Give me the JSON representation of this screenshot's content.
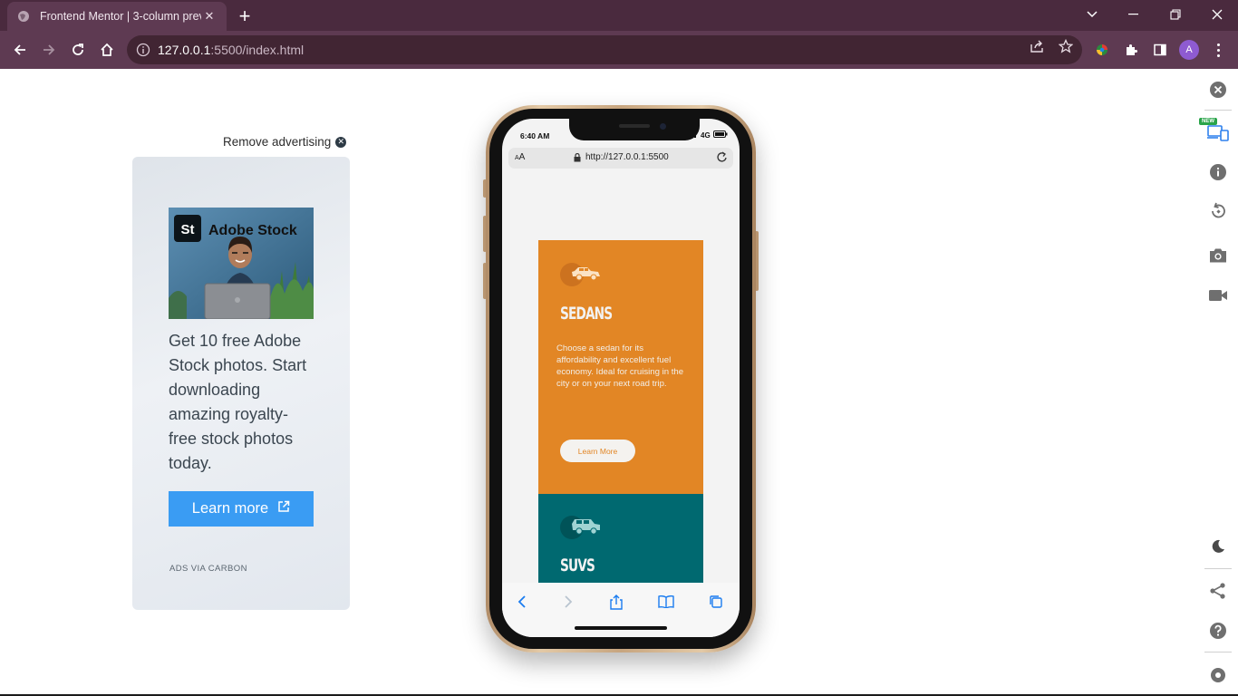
{
  "browser": {
    "tab_title": "Frontend Mentor | 3-column prev",
    "url_host": "127.0.0.1",
    "url_path": ":5500/index.html",
    "profile_initial": "A"
  },
  "ad": {
    "remove_label": "Remove advertising",
    "logo_text": "Adobe Stock",
    "logo_mark": "St",
    "body": "Get 10 free Adobe Stock photos. Start downloading amazing royalty-free stock photos today.",
    "cta_label": "Learn more",
    "via_label": "ADS VIA CARBON"
  },
  "phone": {
    "time": "6:40 AM",
    "network": "4G",
    "text_size": "AA",
    "address": "http://127.0.0.1:5500",
    "cards": [
      {
        "title": "SEDANS",
        "body": "Choose a sedan for its affordability and excellent fuel economy. Ideal for cruising in the city or on your next road trip.",
        "button": "Learn More",
        "color": "#e28625"
      },
      {
        "title": "SUVS",
        "color": "#006970"
      }
    ]
  },
  "side_panel": {
    "new_badge": "NEW"
  },
  "colors": {
    "chrome_dark": "#4a2a3e",
    "chrome_toolbar": "#5e3a52",
    "ad_button": "#3a9cf3",
    "sedan_orange": "#e28625",
    "suv_teal": "#006970"
  }
}
